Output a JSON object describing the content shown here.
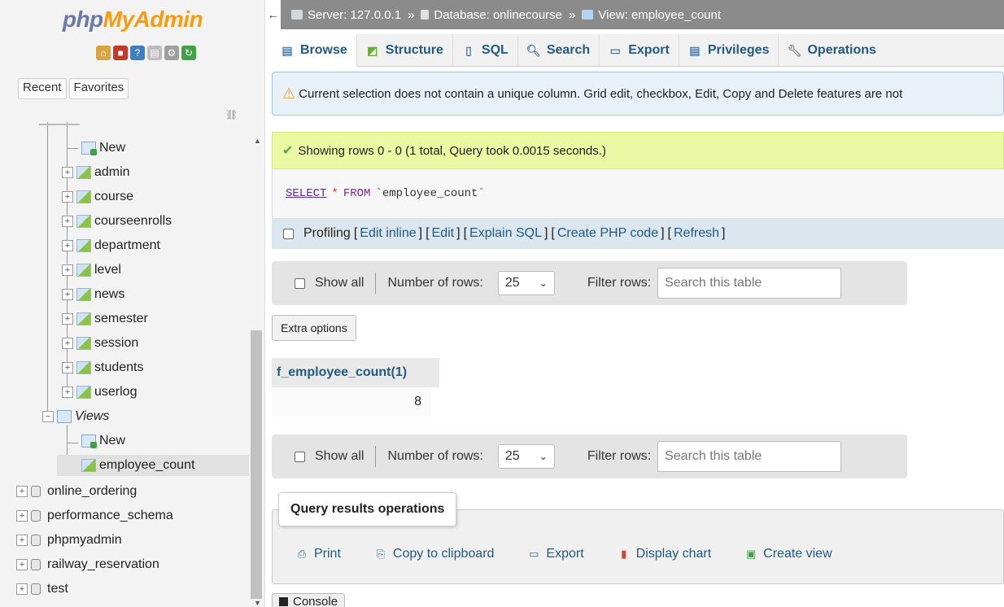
{
  "app": {
    "logo_part1": "php",
    "logo_part2": "MyAdmin"
  },
  "nav": {
    "tabs": [
      "Recent",
      "Favorites"
    ],
    "tables": [
      "admin",
      "course",
      "courseenrolls",
      "department",
      "level",
      "news",
      "semester",
      "session",
      "students",
      "userlog"
    ],
    "new_label": "New",
    "views_label": "Views",
    "views_new_label": "New",
    "view_selected": "employee_count",
    "databases": [
      "online_ordering",
      "performance_schema",
      "phpmyadmin",
      "railway_reservation",
      "test"
    ]
  },
  "breadcrumb": {
    "server": "Server: 127.0.0.1",
    "database": "Database: onlinecourse",
    "view": "View: employee_count",
    "separator": "»"
  },
  "tabs": [
    "Browse",
    "Structure",
    "SQL",
    "Search",
    "Export",
    "Privileges",
    "Operations"
  ],
  "notice": "Current selection does not contain a unique column. Grid edit, checkbox, Edit, Copy and Delete features are not",
  "success": "Showing rows 0 - 0 (1 total, Query took 0.0015 seconds.)",
  "sql": {
    "select": "SELECT",
    "star": "*",
    "from": "FROM",
    "table": "`employee_count`"
  },
  "profiling": {
    "label": "Profiling",
    "links": [
      "Edit inline",
      "Edit",
      "Explain SQL",
      "Create PHP code",
      "Refresh"
    ]
  },
  "navigation": {
    "show_all": "Show all",
    "rows_label": "Number of rows:",
    "rows_value": "25",
    "filter_label": "Filter rows:",
    "filter_placeholder": "Search this table"
  },
  "extra_options": "Extra options",
  "result": {
    "column": "f_employee_count(1)",
    "value": "8"
  },
  "query_ops": {
    "title": "Query results operations",
    "items": [
      "Print",
      "Copy to clipboard",
      "Export",
      "Display chart",
      "Create view"
    ]
  },
  "console": "Console",
  "colors": {
    "link": "#235a81",
    "success_bg": "#ebf8a4",
    "notice_bg": "#e8f0f8",
    "topbar": "#8b8b8b"
  }
}
